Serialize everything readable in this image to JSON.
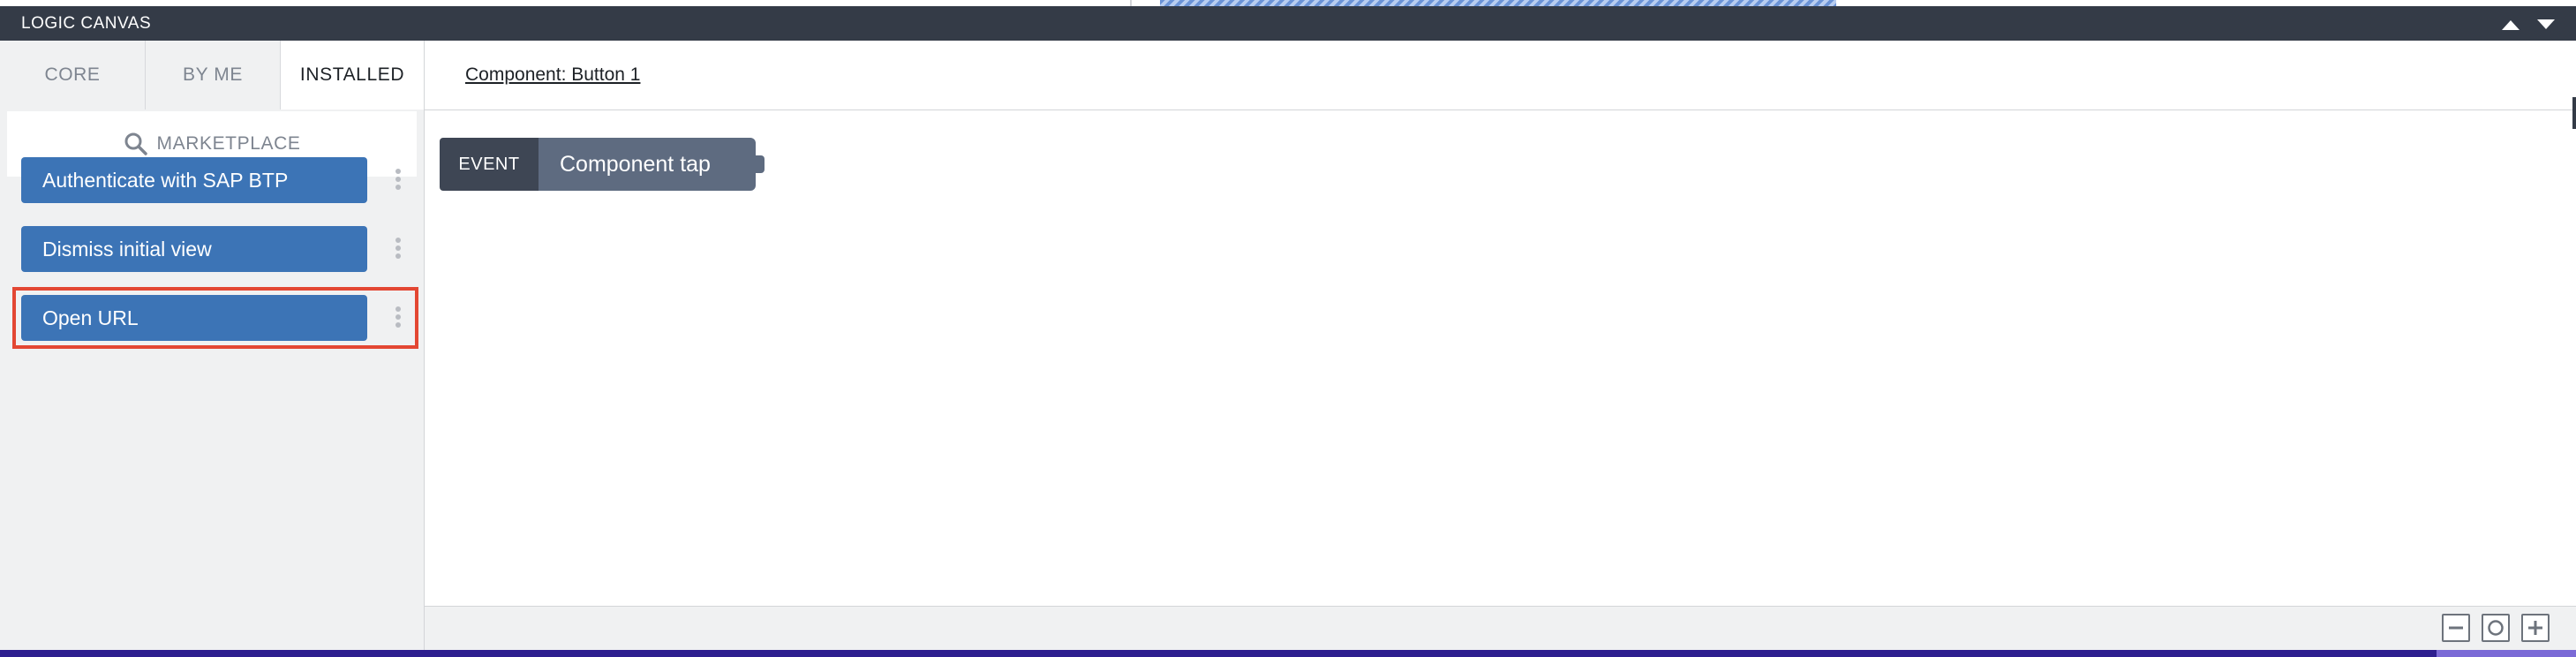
{
  "panel": {
    "title": "LOGIC CANVAS",
    "collapse_icon": "triangle-up-icon",
    "expand_icon": "triangle-down-icon"
  },
  "tabs": [
    {
      "label": "CORE",
      "active": false
    },
    {
      "label": "BY ME",
      "active": false
    },
    {
      "label": "INSTALLED",
      "active": true
    }
  ],
  "marketplace": {
    "label": "MARKETPLACE",
    "icon": "search-icon"
  },
  "flows": [
    {
      "label": "Authenticate with SAP BTP"
    },
    {
      "label": "Dismiss initial view"
    },
    {
      "label": "Open URL",
      "highlighted": true
    }
  ],
  "canvas": {
    "breadcrumb": "Component: Button 1",
    "event_block": {
      "type_label": "EVENT",
      "name": "Component tap"
    }
  },
  "zoom_controls": {
    "out_icon": "minus-icon",
    "reset_icon": "circle-icon",
    "in_icon": "plus-icon"
  },
  "colors": {
    "title_bar": "#343b47",
    "flow_button": "#3c74b6",
    "highlight": "#e34733",
    "event_label": "#3e4654",
    "event_name": "#5e6b80"
  }
}
